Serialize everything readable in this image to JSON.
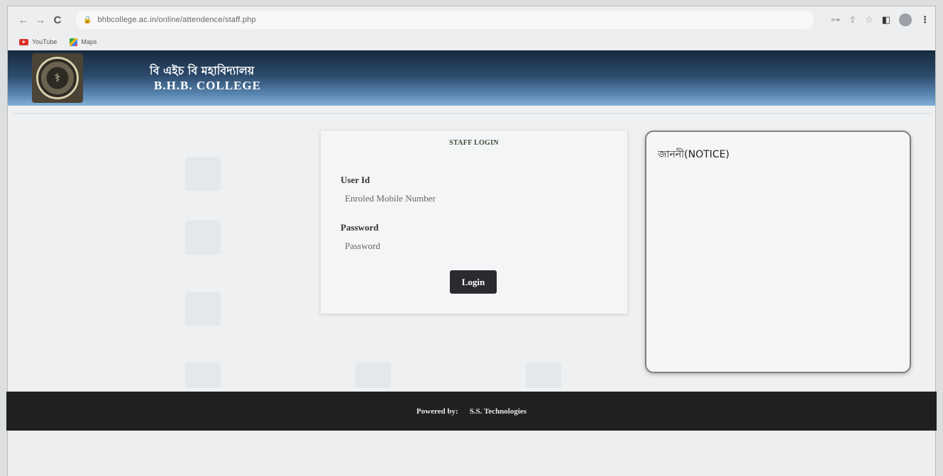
{
  "browser": {
    "url": "bhbcollege.ac.in/online/attendence/staff.php",
    "bookmarks": [
      {
        "label": "YouTube",
        "icon": "youtube-icon"
      },
      {
        "label": "Maps",
        "icon": "maps-icon"
      }
    ],
    "nav_icons": {
      "back": "←",
      "forward": "→",
      "reload": "C"
    }
  },
  "header": {
    "title_bn": "বি এইচ বি মহাবিদ্যালয়",
    "title_en": "B.H.B. COLLEGE",
    "logo_icon": "college-seal"
  },
  "login": {
    "title": "STAFF LOGIN",
    "userid_label": "User Id",
    "userid_placeholder": "Enroled Mobile Number",
    "password_label": "Password",
    "password_placeholder": "Password",
    "button_label": "Login"
  },
  "notice": {
    "title": "জাননী(NOTICE)"
  },
  "footer": {
    "powered_by_label": "Powered by:",
    "company": "S.S. Technologies"
  },
  "colors": {
    "header_dark": "#182a3e",
    "header_light": "#86b0d4",
    "footer_bg": "#1f2021",
    "button_bg": "#2b2a2e"
  }
}
